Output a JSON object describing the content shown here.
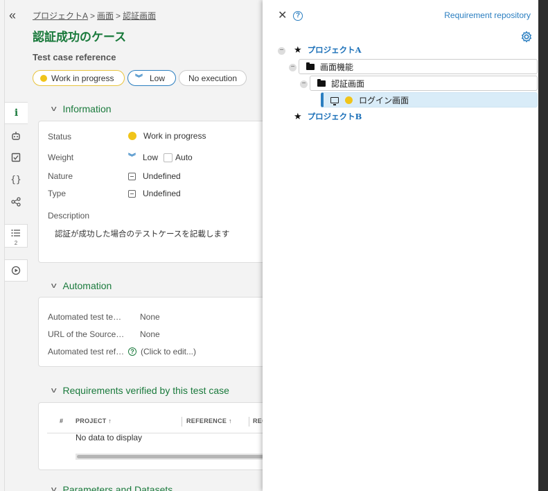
{
  "breadcrumb": {
    "project": "プロジェクトA",
    "sep": ">",
    "screen": "画面",
    "auth": "認証画面"
  },
  "testcase": {
    "title": "認証成功のケース",
    "reference_label": "Test case reference"
  },
  "pills": {
    "status": "Work in progress",
    "weight": "Low",
    "execution": "No execution"
  },
  "sidebar_tools": {
    "requirements_count": "2",
    "info_glyph": "i"
  },
  "information": {
    "heading": "Information",
    "status_label": "Status",
    "status_value": "Work in progress",
    "weight_label": "Weight",
    "weight_value": "Low",
    "auto_label": "Auto",
    "nature_label": "Nature",
    "nature_value": "Undefined",
    "type_label": "Type",
    "type_value": "Undefined",
    "description_label": "Description",
    "description_value": "認証が成功した場合のテストケースを記載します"
  },
  "automation": {
    "heading": "Automation",
    "tech_label": "Automated test technol…",
    "tech_value": "None",
    "url_label": "URL of the Source code …",
    "url_value": "None",
    "ref_label": "Automated test refer…",
    "ref_value": "(Click to edit...)"
  },
  "requirements": {
    "heading": "Requirements verified by this test case",
    "columns": [
      "#",
      "PROJECT",
      "REFERENCE",
      "REQ"
    ],
    "empty": "No data to display"
  },
  "next_section_heading": "Parameters and Datasets",
  "drawer": {
    "title": "Requirement repository",
    "tree": {
      "project_a": "プロジェクトA",
      "folder_screen": "画面機能",
      "folder_auth": "認証画面",
      "req_login": "ログイン画面",
      "project_b": "プロジェクトB"
    }
  },
  "colors": {
    "accent_green": "#1a7a3c",
    "accent_blue": "#2a7ec0",
    "status_yellow": "#f0c419"
  },
  "icons": [
    "collapse-icon",
    "info-icon",
    "robot-icon",
    "checkbox-icon",
    "braces-icon",
    "share-icon",
    "list-icon",
    "play-icon",
    "close-icon",
    "help-icon",
    "gear-icon",
    "star-icon",
    "folder-icon",
    "monitor-icon"
  ]
}
